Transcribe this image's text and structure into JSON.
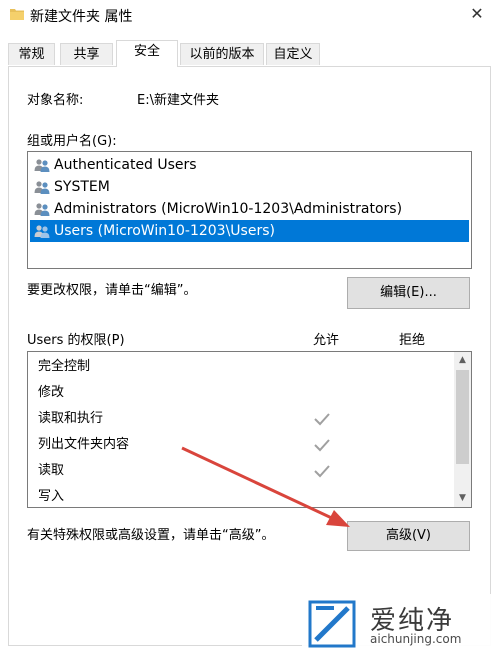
{
  "window": {
    "title": "新建文件夹 属性",
    "close_glyph": "✕"
  },
  "tabs": [
    {
      "label": "常规"
    },
    {
      "label": "共享"
    },
    {
      "label": "安全"
    },
    {
      "label": "以前的版本"
    },
    {
      "label": "自定义"
    }
  ],
  "active_tab": "安全",
  "object": {
    "label": "对象名称:",
    "value": "E:\\新建文件夹"
  },
  "groups": {
    "label": "组或用户名(G):",
    "items": [
      {
        "name": "Authenticated Users"
      },
      {
        "name": "SYSTEM"
      },
      {
        "name": "Administrators (MicroWin10-1203\\Administrators)"
      },
      {
        "name": "Users (MicroWin10-1203\\Users)"
      }
    ],
    "selected": "Users (MicroWin10-1203\\Users)"
  },
  "edit": {
    "hint": "要更改权限，请单击“编辑”。",
    "button_label": "编辑(E)..."
  },
  "permissions": {
    "label": "Users 的权限(P)",
    "allow_label": "允许",
    "deny_label": "拒绝",
    "rows": [
      {
        "name": "完全控制",
        "allow": false,
        "deny": false
      },
      {
        "name": "修改",
        "allow": false,
        "deny": false
      },
      {
        "name": "读取和执行",
        "allow": true,
        "deny": false
      },
      {
        "name": "列出文件夹内容",
        "allow": true,
        "deny": false
      },
      {
        "name": "读取",
        "allow": true,
        "deny": false
      },
      {
        "name": "写入",
        "allow": false,
        "deny": false
      }
    ]
  },
  "advanced": {
    "hint": "有关特殊权限或高级设置，请单击“高级”。",
    "button_label": "高级(V)"
  },
  "watermark": {
    "name": "爱纯净",
    "url": "aichunjing.com"
  },
  "colors": {
    "selection": "#0078d7",
    "arrow": "#d9453c",
    "check": "#a0a0a0"
  }
}
